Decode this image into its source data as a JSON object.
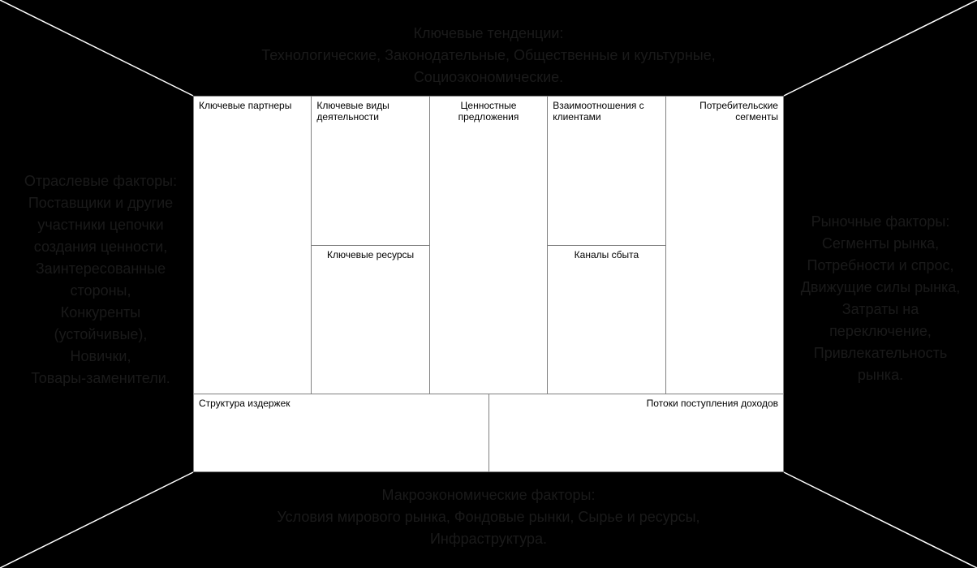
{
  "frame": {
    "top": {
      "title": "Ключевые тенденции:",
      "lines": [
        "Технологические, Законодательные, Общественные и культурные,",
        "Социоэкономические."
      ]
    },
    "bottom": {
      "title": "Макроэкономические факторы:",
      "lines": [
        "Условия мирового рынка, Фондовые рынки, Сырье и ресурсы,",
        "Инфраструктура."
      ]
    },
    "left": {
      "title": "Отраслевые факторы:",
      "lines": [
        "Поставщики и другие",
        "участники цепочки",
        "создания ценности,",
        "Заинтересованные",
        "стороны,",
        "Конкуренты",
        "(устойчивые),",
        "Новички,",
        "Товары-заменители."
      ]
    },
    "right": {
      "title": "Рыночные факторы:",
      "lines": [
        "Сегменты рынка,",
        "Потребности и спрос,",
        "Движущие силы рынка,",
        "Затраты на",
        "переключение,",
        "Привлекательность рынка."
      ]
    }
  },
  "canvas": {
    "key_partners": "Ключевые партнеры",
    "key_activities": "Ключевые виды деятельности",
    "key_resources": "Ключевые ресурсы",
    "value_propositions": "Ценностные предложения",
    "customer_relationships": "Взаимоотношения с клиентами",
    "channels": "Каналы сбыта",
    "customer_segments": "Потребительские сегменты",
    "cost_structure": "Структура издержек",
    "revenue_streams": "Потоки поступления доходов"
  }
}
